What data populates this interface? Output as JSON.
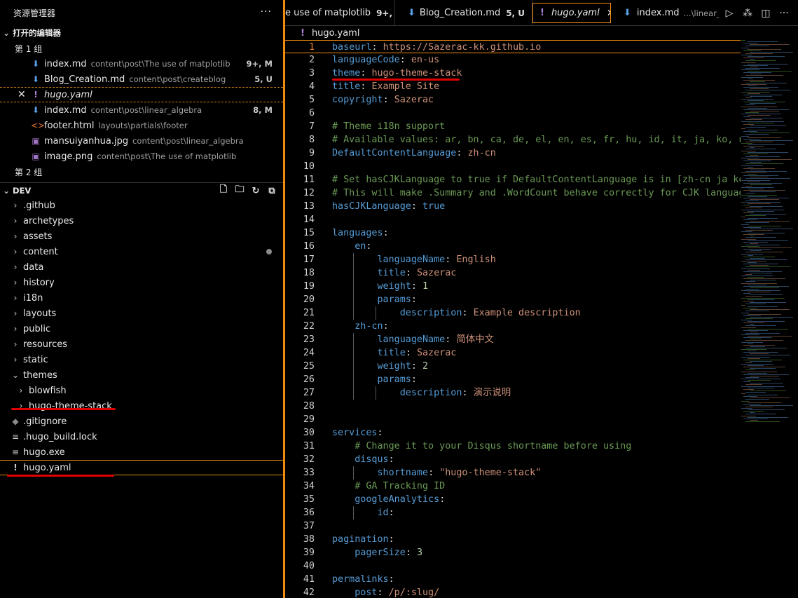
{
  "sidebar": {
    "title": "资源管理器",
    "more": "···",
    "open_editors": {
      "title": "打开的编辑器",
      "group1": "第 1 组",
      "group2": "第 2 组",
      "files": [
        {
          "name": "index.md",
          "path": "content\\post\\The use of matplotlib",
          "badge": "9+, M",
          "icon": "download-file-icon"
        },
        {
          "name": "Blog_Creation.md",
          "path": "content\\post\\createblog",
          "badge": "5, U",
          "icon": "download-file-icon"
        },
        {
          "name": "hugo.yaml",
          "path": "",
          "badge": "",
          "icon": "yaml-icon"
        },
        {
          "name": "index.md",
          "path": "content\\post\\linear_algebra",
          "badge": "8, M",
          "icon": "download-file-icon"
        },
        {
          "name": "footer.html",
          "path": "layouts\\partials\\footer",
          "badge": "",
          "icon": "html-icon"
        },
        {
          "name": "mansuiyanhua.jpg",
          "path": "content\\post\\linear_algebra",
          "badge": "",
          "icon": "image-icon"
        },
        {
          "name": "image.png",
          "path": "content\\post\\The use of matplotlib",
          "badge": "",
          "icon": "image-icon"
        }
      ]
    },
    "workspace": {
      "title": "DEV",
      "items": [
        {
          "label": ".github"
        },
        {
          "label": "archetypes"
        },
        {
          "label": "assets"
        },
        {
          "label": "content"
        },
        {
          "label": "data"
        },
        {
          "label": "history"
        },
        {
          "label": "i18n"
        },
        {
          "label": "layouts"
        },
        {
          "label": "public"
        },
        {
          "label": "resources"
        },
        {
          "label": "static"
        },
        {
          "label": "themes"
        },
        {
          "label": "blowfish"
        },
        {
          "label": "hugo-theme-stack"
        },
        {
          "label": ".gitignore"
        },
        {
          "label": ".hugo_build.lock"
        },
        {
          "label": "hugo.exe"
        },
        {
          "label": "hugo.yaml"
        }
      ]
    }
  },
  "tabs": [
    {
      "label": "e use of matplotlib",
      "badge": "9+, M",
      "path": ""
    },
    {
      "label": "Blog_Creation.md",
      "badge": "5, U",
      "path": ""
    },
    {
      "label": "hugo.yaml",
      "badge": "",
      "path": ""
    },
    {
      "label": "index.md",
      "badge": "",
      "path": "...\\linear_al"
    }
  ],
  "breadcrumb": {
    "file": "hugo.yaml"
  },
  "code_lines": [
    "baseurl: https://Sazerac-kk.github.io",
    "languageCode: en-us",
    "theme: hugo-theme-stack",
    "title: Example Site",
    "copyright: Sazerac",
    "",
    "# Theme i18n support",
    "# Available values: ar, bn, ca, de, el, en, es, fr, hu, id, it, ja, ko, nl",
    "DefaultContentLanguage: zh-cn",
    "",
    "# Set hasCJKLanguage to true if DefaultContentLanguage is in [zh-cn ja ko]",
    "# This will make .Summary and .WordCount behave correctly for CJK languages",
    "hasCJKLanguage: true",
    "",
    "languages:",
    "    en:",
    "        languageName: English",
    "        title: Sazerac",
    "        weight: 1",
    "        params:",
    "            description: Example description",
    "    zh-cn:",
    "        languageName: 简体中文",
    "        title: Sazerac",
    "        weight: 2",
    "        params:",
    "            description: 演示说明",
    "",
    "",
    "services:",
    "    # Change it to your Disqus shortname before using",
    "    disqus:",
    "        shortname: \"hugo-theme-stack\"",
    "    # GA Tracking ID",
    "    googleAnalytics:",
    "        id:",
    "",
    "pagination:",
    "    pagerSize: 3",
    "",
    "permalinks:",
    "    post: /p/:slug/"
  ],
  "colors": {
    "accent": "#f28a10",
    "annotation": "#e00000",
    "key": "#569cd6",
    "string": "#ce9178",
    "comment": "#6a9955",
    "number": "#b5cea8"
  }
}
